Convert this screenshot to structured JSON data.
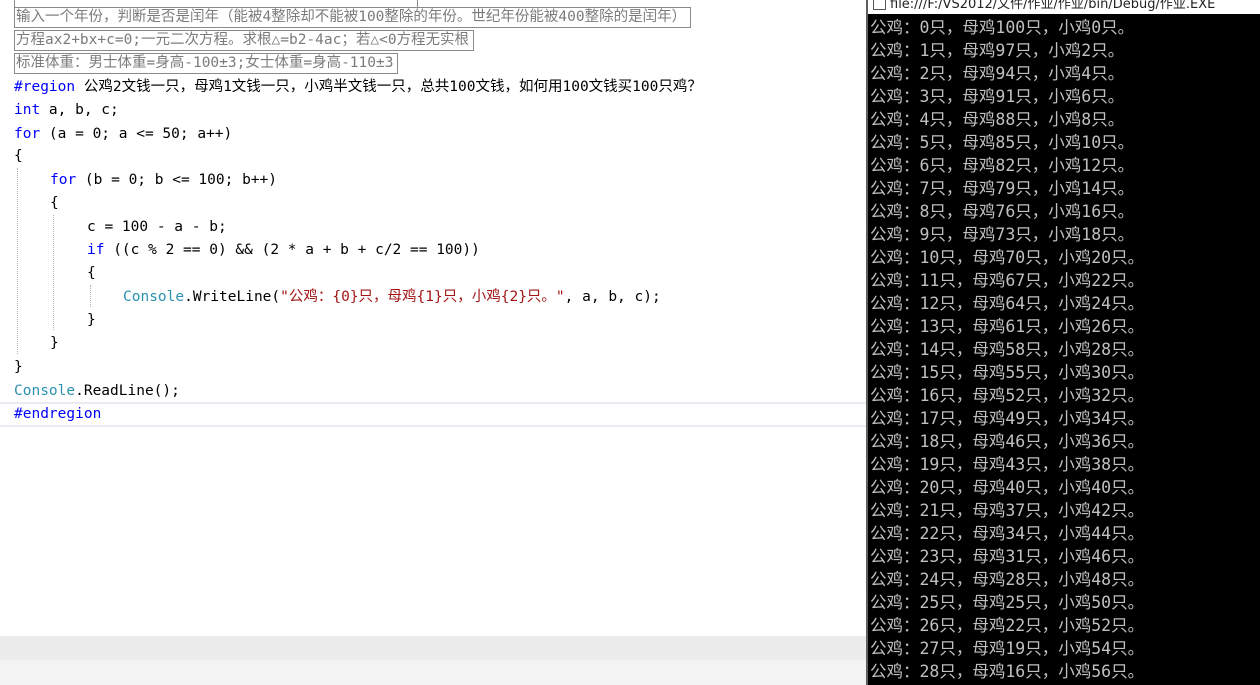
{
  "editor": {
    "collapsed_lines": [
      "输入一个年份，判断是否是闰年（能被4整除却不能被100整除的年份。世纪年份能被400整除的是闰年）",
      "方程ax2+bx+c=0;一元二次方程。求根△=b2-4ac；若△<0方程无实根",
      "标准体重：男士体重=身高-100±3;女士体重=身高-110±3"
    ],
    "region_keyword": "#region",
    "region_title": " 公鸡2文钱一只，母鸡1文钱一只，小鸡半文钱一只，总共100文钱，如何用100文钱买100只鸡？",
    "line_decl_kw": "int",
    "line_decl_rest": " a, b, c;",
    "for1_kw": "for",
    "for1_rest": " (a = 0; a <= 50; a++)",
    "brace_open": "{",
    "brace_close": "}",
    "for2_kw": "for",
    "for2_rest": " (b = 0; b <= 100; b++)",
    "assign": "c = 100 - a - b;",
    "if_kw": "if",
    "if_rest": " ((c % 2 == 0) && (2 * a + b + c/2 == 100))",
    "console_type": "Console",
    "writeline_method": ".WriteLine(",
    "writeline_string": "\"公鸡：{0}只，母鸡{1}只，小鸡{2}只。\"",
    "writeline_args": ", a, b, c);",
    "readline_method": ".ReadLine();",
    "endregion": "#endregion"
  },
  "console": {
    "title": "file:///F:/VS2012/文件/作业/作业/bin/Debug/作业.EXE",
    "lines": [
      "公鸡：0只，母鸡100只，小鸡0只。",
      "公鸡：1只，母鸡97只，小鸡2只。",
      "公鸡：2只，母鸡94只，小鸡4只。",
      "公鸡：3只，母鸡91只，小鸡6只。",
      "公鸡：4只，母鸡88只，小鸡8只。",
      "公鸡：5只，母鸡85只，小鸡10只。",
      "公鸡：6只，母鸡82只，小鸡12只。",
      "公鸡：7只，母鸡79只，小鸡14只。",
      "公鸡：8只，母鸡76只，小鸡16只。",
      "公鸡：9只，母鸡73只，小鸡18只。",
      "公鸡：10只，母鸡70只，小鸡20只。",
      "公鸡：11只，母鸡67只，小鸡22只。",
      "公鸡：12只，母鸡64只，小鸡24只。",
      "公鸡：13只，母鸡61只，小鸡26只。",
      "公鸡：14只，母鸡58只，小鸡28只。",
      "公鸡：15只，母鸡55只，小鸡30只。",
      "公鸡：16只，母鸡52只，小鸡32只。",
      "公鸡：17只，母鸡49只，小鸡34只。",
      "公鸡：18只，母鸡46只，小鸡36只。",
      "公鸡：19只，母鸡43只，小鸡38只。",
      "公鸡：20只，母鸡40只，小鸡40只。",
      "公鸡：21只，母鸡37只，小鸡42只。",
      "公鸡：22只，母鸡34只，小鸡44只。",
      "公鸡：23只，母鸡31只，小鸡46只。",
      "公鸡：24只，母鸡28只，小鸡48只。",
      "公鸡：25只，母鸡25只，小鸡50只。",
      "公鸡：26只，母鸡22只，小鸡52只。",
      "公鸡：27只，母鸡19只，小鸡54只。",
      "公鸡：28只，母鸡16只，小鸡56只。"
    ]
  }
}
